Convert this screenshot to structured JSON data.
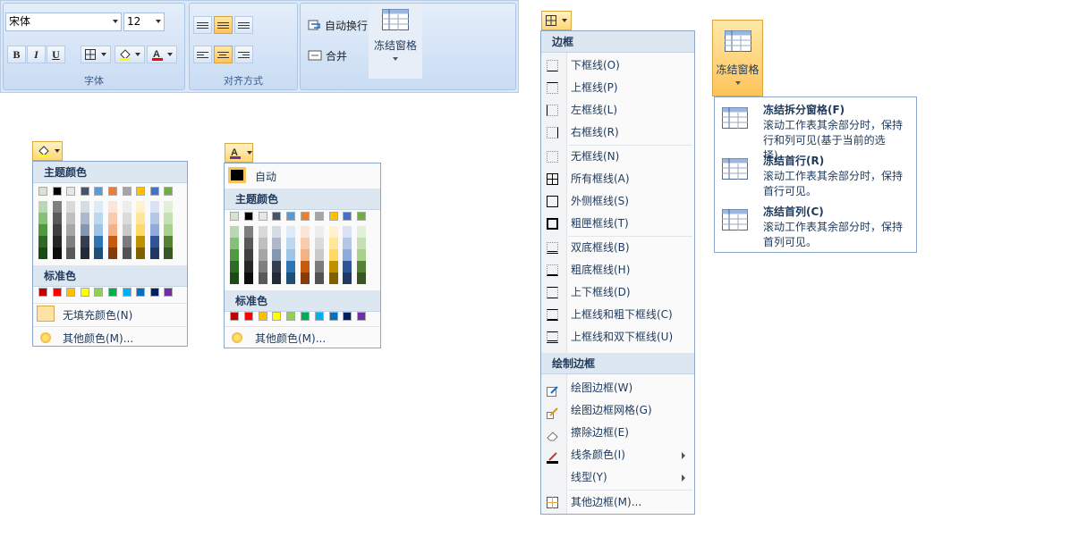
{
  "ribbon": {
    "font_group_label": "字体",
    "align_group_label": "对齐方式",
    "font_name": "宋体",
    "font_size": "12",
    "bold": "B",
    "italic": "I",
    "underline": "U",
    "wrap_text": "自动换行",
    "merge": "合并",
    "freeze_panes": "冻结窗格"
  },
  "fill_menu": {
    "theme_colors_header": "主题颜色",
    "standard_colors_header": "标准色",
    "no_fill": "无填充颜色(N)",
    "more_colors": "其他颜色(M)..."
  },
  "font_color_menu": {
    "automatic": "自动",
    "theme_colors_header": "主题颜色",
    "standard_colors_header": "标准色",
    "more_colors": "其他颜色(M)..."
  },
  "theme_colors": {
    "top_row": [
      "#d6e4d0",
      "#000000",
      "#e6e6e6",
      "#44546a",
      "#5b9bd5",
      "#ed7d31",
      "#a5a5a5",
      "#ffc000",
      "#4472c4",
      "#70ad47"
    ],
    "columns": [
      [
        "#b9d7b2",
        "#86c07a",
        "#4f9a41",
        "#2e6a25",
        "#1c4a16"
      ],
      [
        "#7f7f7f",
        "#595959",
        "#404040",
        "#262626",
        "#0d0d0d"
      ],
      [
        "#d9d9d9",
        "#bfbfbf",
        "#a6a6a6",
        "#7f7f7f",
        "#595959"
      ],
      [
        "#d6dce4",
        "#adb9ca",
        "#8497b0",
        "#333f4f",
        "#222b35"
      ],
      [
        "#ddebf7",
        "#bdd7ee",
        "#9dc3e6",
        "#2e75b6",
        "#1f4e79"
      ],
      [
        "#fbe5d6",
        "#f8cbad",
        "#f4b183",
        "#c55a11",
        "#843c0c"
      ],
      [
        "#ededed",
        "#dbdbdb",
        "#c9c9c9",
        "#7b7b7b",
        "#525252"
      ],
      [
        "#fff2cc",
        "#ffe699",
        "#ffd966",
        "#bf9000",
        "#7f6000"
      ],
      [
        "#dae3f3",
        "#b4c7e7",
        "#8faadc",
        "#2f5597",
        "#203864"
      ],
      [
        "#e2f0d9",
        "#c5e0b4",
        "#a9d18e",
        "#548235",
        "#375623"
      ]
    ],
    "standard": [
      "#c00000",
      "#ff0000",
      "#ffc000",
      "#ffff00",
      "#92d050",
      "#00b050",
      "#00b0f0",
      "#0070c0",
      "#002060",
      "#7030a0"
    ]
  },
  "border_menu": {
    "header": "边框",
    "items": [
      "下框线(O)",
      "上框线(P)",
      "左框线(L)",
      "右框线(R)",
      "无框线(N)",
      "所有框线(A)",
      "外侧框线(S)",
      "粗匣框线(T)",
      "双底框线(B)",
      "粗底框线(H)",
      "上下框线(D)",
      "上框线和粗下框线(C)",
      "上框线和双下框线(U)"
    ],
    "draw_header": "绘制边框",
    "draw_items": [
      "绘图边框(W)",
      "绘图边框网格(G)",
      "擦除边框(E)",
      "线条颜色(I)",
      "线型(Y)"
    ],
    "more": "其他边框(M)..."
  },
  "freeze_menu": {
    "button_label": "冻结窗格",
    "items": [
      {
        "title": "冻结拆分窗格(F)",
        "desc": "滚动工作表其余部分时，保持行和列可见(基于当前的选择)。"
      },
      {
        "title": "冻结首行(R)",
        "desc": "滚动工作表其余部分时，保持首行可见。"
      },
      {
        "title": "冻结首列(C)",
        "desc": "滚动工作表其余部分时，保持首列可见。"
      }
    ]
  }
}
